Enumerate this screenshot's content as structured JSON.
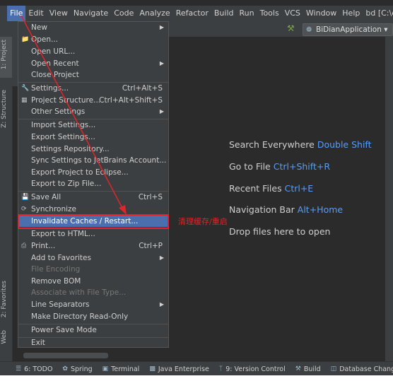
{
  "menubar": {
    "items": [
      "File",
      "Edit",
      "View",
      "Navigate",
      "Code",
      "Analyze",
      "Refactor",
      "Build",
      "Run",
      "Tools",
      "VCS",
      "Window",
      "Help"
    ],
    "title": "bd [C:\\develop"
  },
  "toolbar": {
    "run_config": "BiDianApplication ▾"
  },
  "left_tabs": {
    "project": "1: Project",
    "structure": "Z: Structure",
    "favorites": "2: Favorites",
    "web": "Web"
  },
  "file_menu": {
    "new": "New",
    "open": "Open...",
    "open_url": "Open URL...",
    "open_recent": "Open Recent",
    "close_project": "Close Project",
    "settings": "Settings...",
    "settings_shortcut": "Ctrl+Alt+S",
    "project_structure": "Project Structure...",
    "project_structure_shortcut": "Ctrl+Alt+Shift+S",
    "other_settings": "Other Settings",
    "import_settings": "Import Settings...",
    "export_settings": "Export Settings...",
    "settings_repository": "Settings Repository...",
    "sync_settings": "Sync Settings to JetBrains Account...",
    "export_eclipse": "Export Project to Eclipse...",
    "export_zip": "Export to Zip File...",
    "save_all": "Save All",
    "save_all_shortcut": "Ctrl+S",
    "synchronize": "Synchronize",
    "invalidate": "Invalidate Caches / Restart...",
    "export_html": "Export to HTML...",
    "print": "Print...",
    "print_shortcut": "Ctrl+P",
    "add_favorites": "Add to Favorites",
    "file_encoding": "File Encoding",
    "remove_bom": "Remove BOM",
    "associate": "Associate with File Type...",
    "line_separators": "Line Separators",
    "make_readonly": "Make Directory Read-Only",
    "power_save": "Power Save Mode",
    "exit": "Exit"
  },
  "annotation": "清理缓存/重启",
  "welcome": {
    "search_label": "Search Everywhere",
    "search_key": "Double Shift",
    "goto_label": "Go to File",
    "goto_key": "Ctrl+Shift+R",
    "recent_label": "Recent Files",
    "recent_key": "Ctrl+E",
    "navbar_label": "Navigation Bar",
    "navbar_key": "Alt+Home",
    "drop_label": "Drop files here to open"
  },
  "bottom_tabs": [
    "6: TODO",
    "Spring",
    "Terminal",
    "Java Enterprise",
    "9: Version Control",
    "Build",
    "Database Changes"
  ],
  "colors": {
    "accent": "#4b6eaf",
    "highlight": "#e0242b",
    "key": "#589df6"
  }
}
